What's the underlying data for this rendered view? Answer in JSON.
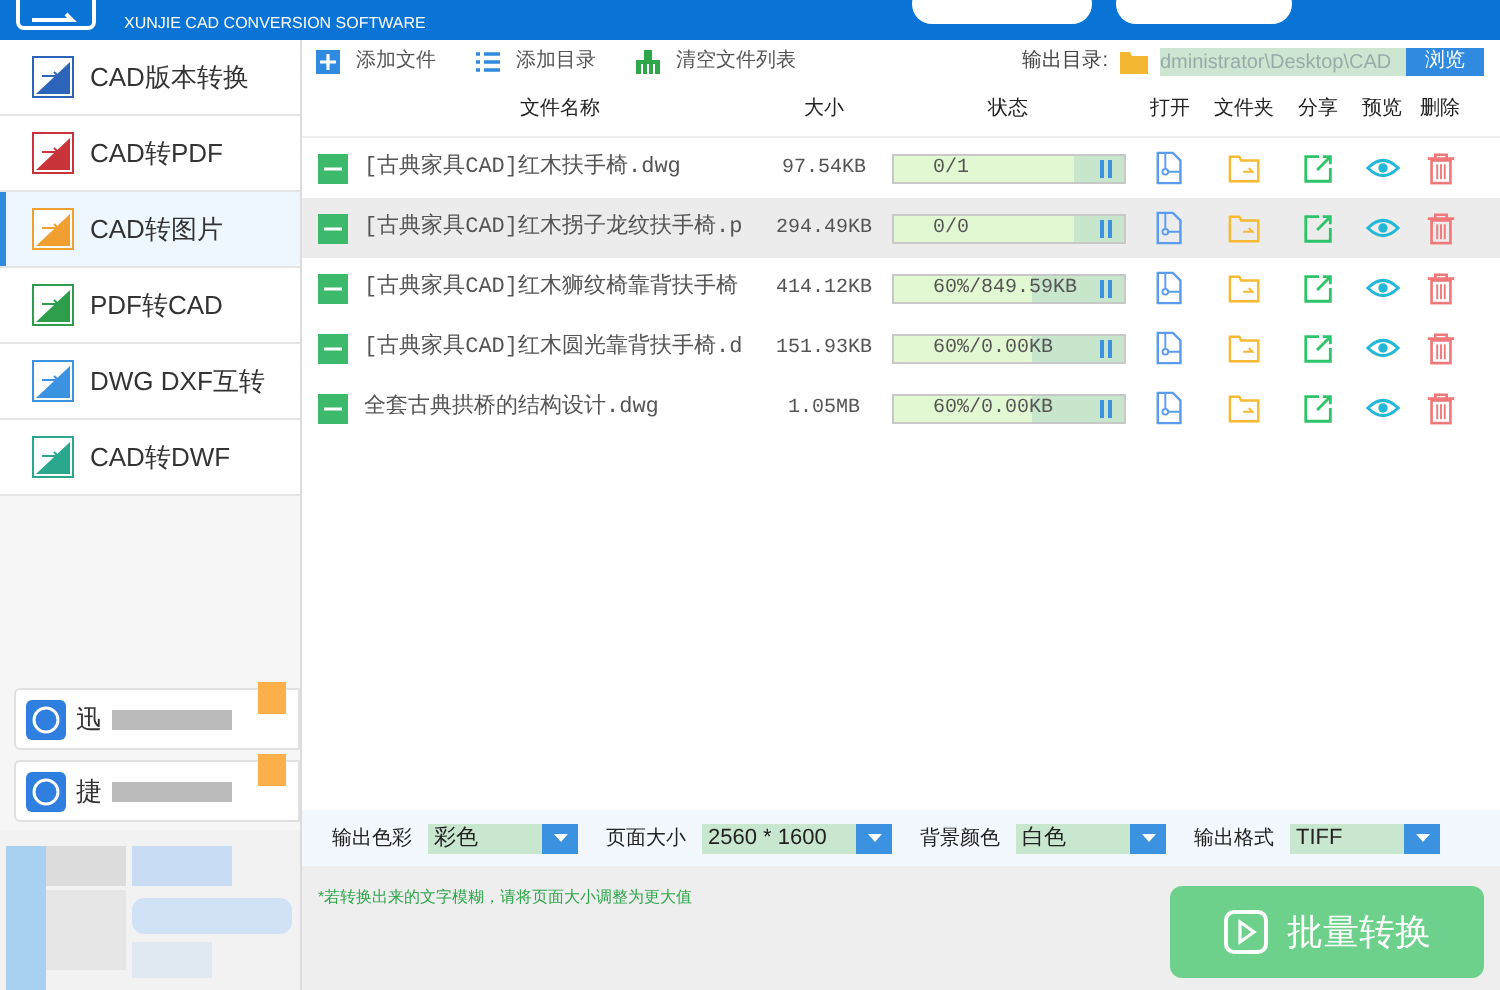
{
  "header": {
    "subtitle": "XUNJIE CAD CONVERSION SOFTWARE"
  },
  "sidebar": {
    "items": [
      {
        "label": "CAD版本转换",
        "kind": "version",
        "selected": false
      },
      {
        "label": "CAD转PDF",
        "kind": "pdf",
        "selected": false
      },
      {
        "label": "CAD转图片",
        "selected": true
      },
      {
        "label": "PDF转CAD",
        "kind": "pdf2cad",
        "selected": false
      },
      {
        "label": "DWG DXF互转",
        "kind": "dwgdxf",
        "selected": false
      },
      {
        "label": "CAD转DWF",
        "kind": "dwf",
        "selected": false
      }
    ],
    "promos": [
      {
        "label": "迅"
      },
      {
        "label": "捷"
      }
    ]
  },
  "toolbar": {
    "buttons": [
      {
        "label": "添加文件",
        "kind": "add"
      },
      {
        "label": "添加目录",
        "kind": "list"
      },
      {
        "label": "清空文件列表",
        "kind": "clear"
      }
    ],
    "output_label": "输出目录:",
    "output_path": "dministrator\\Desktop\\CAD",
    "browse": "浏览"
  },
  "table": {
    "columns": [
      "文件名称",
      "大小",
      "状态",
      "打开",
      "文件夹",
      "分享",
      "预览",
      "删除"
    ],
    "rows": [
      {
        "name": "[古典家具CAD]红木扶手椅.dwg",
        "size": "97.54KB",
        "status": "0/1",
        "level": 0.79,
        "selected": false
      },
      {
        "name": "[古典家具CAD]红木拐子龙纹扶手椅.p",
        "size": "294.49KB",
        "status": "0/0",
        "level": 0.79,
        "selected": true
      },
      {
        "name": "[古典家具CAD]红木狮纹椅靠背扶手椅",
        "size": "414.12KB",
        "status": "60%/849.59KB",
        "level": 0.6,
        "selected": false
      },
      {
        "name": "[古典家具CAD]红木圆光靠背扶手椅.d",
        "size": "151.93KB",
        "status": "60%/0.00KB",
        "level": 0.6,
        "selected": false
      },
      {
        "name": "全套古典拱桥的结构设计.dwg",
        "size": "1.05MB",
        "status": "60%/0.00KB",
        "level": 0.6,
        "selected": false
      }
    ]
  },
  "options": [
    {
      "label": "输出色彩",
      "value": "彩色"
    },
    {
      "label": "页面大小",
      "value": "2560 * 1600"
    },
    {
      "label": "背景颜色",
      "value": "白色"
    },
    {
      "label": "输出格式",
      "value": "TIFF"
    }
  ],
  "hint": "*若转换出来的文字模糊，请将页面大小调整为更大值",
  "convert_button": "批量转换"
}
